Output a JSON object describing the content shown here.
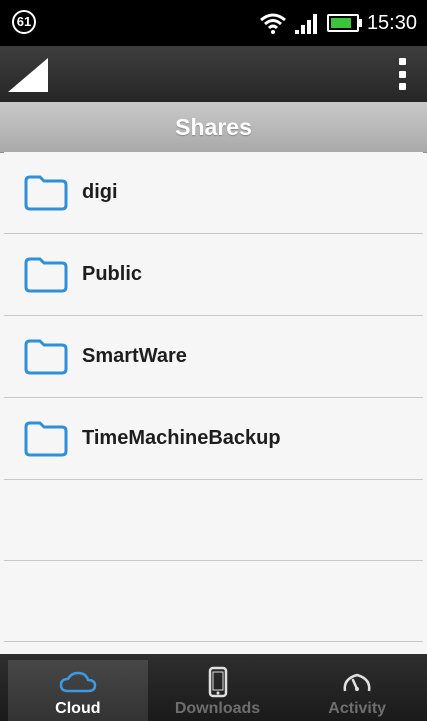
{
  "status_bar": {
    "notification_count": "61",
    "time": "15:30",
    "icons": [
      "wifi-icon",
      "signal-icon",
      "battery-icon"
    ]
  },
  "action_bar": {
    "logo_icon": "corner-triangle-icon",
    "overflow_icon": "overflow-menu-icon"
  },
  "title": "Shares",
  "shares": [
    {
      "label": "digi"
    },
    {
      "label": "Public"
    },
    {
      "label": "SmartWare"
    },
    {
      "label": "TimeMachineBackup"
    }
  ],
  "tabs": [
    {
      "label": "Cloud",
      "icon": "cloud-icon",
      "active": true
    },
    {
      "label": "Downloads",
      "icon": "phone-icon",
      "active": false
    },
    {
      "label": "Activity",
      "icon": "gauge-icon",
      "active": false
    }
  ],
  "colors": {
    "folder_stroke": "#2f8fd8",
    "tab_active_icon": "#3a9ae6",
    "tab_inactive": "#6e6e6e"
  }
}
